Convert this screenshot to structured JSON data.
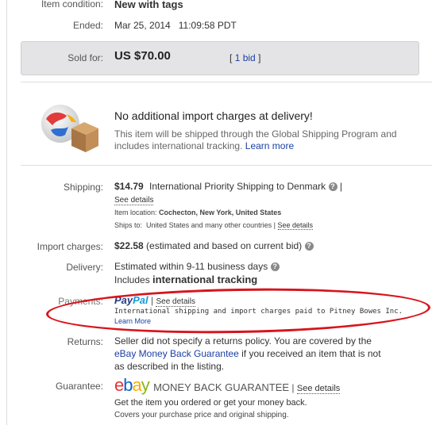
{
  "condition": {
    "label": "Item condition:",
    "value": "New with tags"
  },
  "ended": {
    "label": "Ended:",
    "date": "Mar 25, 2014",
    "time": "11:09:58 PDT"
  },
  "sold": {
    "label": "Sold for:",
    "price": "US $70.00",
    "bid_open": "[",
    "bids": "1 bid",
    "bid_close": "]"
  },
  "gsp": {
    "heading": "No additional import charges at delivery!",
    "text": "This item will be shipped through the Global Shipping Program and includes international tracking.",
    "learn_more": "Learn more"
  },
  "shipping": {
    "label": "Shipping:",
    "price": "$14.79",
    "service": "International Priority Shipping to Denmark",
    "sep": "|",
    "see_details": "See details",
    "location_label": "Item location:",
    "location": "Cochecton, New York, United States",
    "ships_to_label": "Ships to:",
    "ships_to": "United States and many other countries",
    "ships_to_sep": "|",
    "ships_to_details": "See details"
  },
  "import": {
    "label": "Import charges:",
    "price": "$22.58",
    "note": "(estimated and based on current bid)"
  },
  "delivery": {
    "label": "Delivery:",
    "estimate": "Estimated within 9-11 business days",
    "includes": "Includes",
    "tracking": "international tracking"
  },
  "payments": {
    "label": "Payments:",
    "paypal_a": "Pay",
    "paypal_b": "Pal",
    "sep": "|",
    "see_details": "See details",
    "note": "International shipping and import charges paid to Pitney Bowes Inc.",
    "learn_more": "Learn More"
  },
  "returns": {
    "label": "Returns:",
    "line1": "Seller did not specify a returns policy. You are covered by the",
    "link": "eBay Money Back Guarantee",
    "line2": "if you received an item that is not",
    "line3": "as described in the listing."
  },
  "guarantee": {
    "label": "Guarantee:",
    "logo": [
      "e",
      "b",
      "a",
      "y"
    ],
    "title": "MONEY BACK GUARANTEE",
    "sep": "|",
    "see_details": "See details",
    "line1": "Get the item you ordered or get your money back.",
    "line2": "Covers your purchase price and original shipping."
  },
  "colors": {
    "link": "#1a3fa5",
    "annotation": "#d8141b",
    "ebay_e": "#e53238",
    "ebay_b": "#0064d2",
    "ebay_a": "#f5af02",
    "ebay_y": "#86b817"
  }
}
